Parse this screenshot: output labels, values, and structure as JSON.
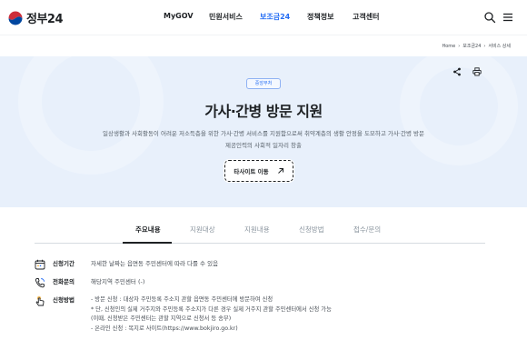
{
  "header": {
    "logo_text": "정부24",
    "nav": [
      "MyGOV",
      "민원서비스",
      "보조금24",
      "정책정보",
      "고객센터"
    ],
    "active_nav": "보조금24",
    "icons": [
      "search-icon",
      "menu-icon"
    ]
  },
  "breadcrumb": [
    "Home",
    "보조금24",
    "서비스 상세"
  ],
  "hero": {
    "badge": "중앙부처",
    "title": "가사·간병 방문 지원",
    "description_lines": [
      "일상생활과 사회활동이 어려운 저소득층을 위한 가사·간병 서비스를 지원함으로써 취약계층의 생활 안정을 도모하고 가사·간병 방문",
      "제공인력의 사회적 일자리 창출"
    ],
    "button_label": "타사이트 이동",
    "tools": [
      "share-icon",
      "print-icon"
    ]
  },
  "tabs": [
    "주요내용",
    "지원대상",
    "지원내용",
    "신청방법",
    "접수/문의"
  ],
  "active_tab": "주요내용",
  "info": {
    "period_label": "신청기간",
    "period_value": "자세한 날짜는 읍면동 주민센터에 따라 다를 수 있음",
    "phone_label": "전화문의",
    "phone_value": "해당지역 주민센터 (-)",
    "method_label": "신청방법",
    "method_lines": [
      "- 방문 신청 : 대상자 주민등록 주소지 관할 읍면동 주민센터에 방문하여 신청",
      "* 단, 신청인의 실제 거주지와 주민등록 주소지가 다른 경우 실제 거주지 관할 주민센터에서 신청 가능",
      "(이때, 신청받은 주민센터는 관할 지역으로 신청서 등 송부)",
      "- 온라인 신청 : 복지로 사이트(https://www.bokjiro.go.kr)"
    ]
  },
  "colors": {
    "accent": "#256ef4",
    "hero_bg": "#e8f0fb",
    "text": "#1e2124"
  }
}
